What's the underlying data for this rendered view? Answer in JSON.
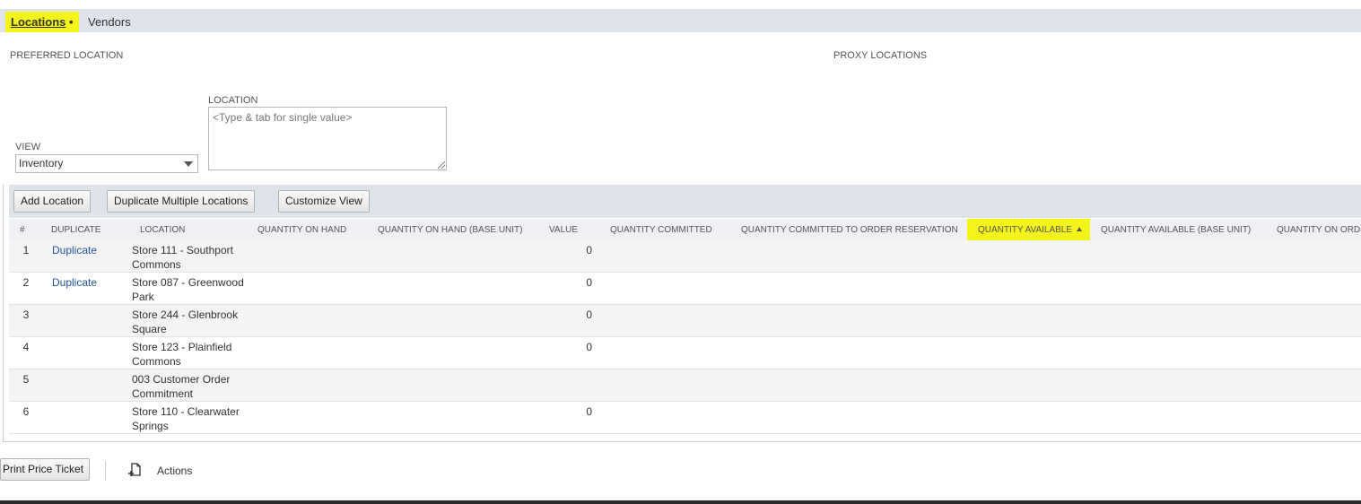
{
  "tabs": {
    "locations": "Locations",
    "locations_marker": "•",
    "vendors": "Vendors"
  },
  "sections": {
    "preferred_location": "PREFERRED LOCATION",
    "proxy_locations": "PROXY LOCATIONS"
  },
  "filters": {
    "view_label": "VIEW",
    "view_value": "Inventory",
    "location_label": "LOCATION",
    "location_placeholder": "<Type & tab for single value>"
  },
  "buttons": {
    "add_location": "Add Location",
    "duplicate_multiple": "Duplicate Multiple Locations",
    "customize_view": "Customize View",
    "print_price_ticket": "Print Price Ticket",
    "actions": "Actions"
  },
  "grid": {
    "columns": [
      "#",
      "DUPLICATE",
      "LOCATION",
      "QUANTITY ON HAND",
      "QUANTITY ON HAND (BASE UNIT)",
      "VALUE",
      "QUANTITY COMMITTED",
      "QUANTITY COMMITTED TO ORDER RESERVATION",
      "QUANTITY AVAILABLE",
      "QUANTITY AVAILABLE (BASE UNIT)",
      "QUANTITY ON ORDE"
    ],
    "rows": [
      {
        "num": "1",
        "duplicate": "Duplicate",
        "location": "Store 111 - Southport Commons",
        "value": "0"
      },
      {
        "num": "2",
        "duplicate": "Duplicate",
        "location": "Store 087 - Greenwood Park",
        "value": "0"
      },
      {
        "num": "3",
        "duplicate": "",
        "location": "Store 244 - Glenbrook Square",
        "value": "0"
      },
      {
        "num": "4",
        "duplicate": "",
        "location": "Store 123 - Plainfield Commons",
        "value": "0"
      },
      {
        "num": "5",
        "duplicate": "",
        "location": "003 Customer Order Commitment",
        "value": ""
      },
      {
        "num": "6",
        "duplicate": "",
        "location": "Store 110 - Clearwater Springs",
        "value": "0"
      }
    ]
  },
  "colors": {
    "highlight": "#f4f41a",
    "link": "#255599",
    "bar": "#dfe4eb"
  },
  "icons": {
    "sort": "sort-asc-icon",
    "actions": "actions-icon"
  }
}
